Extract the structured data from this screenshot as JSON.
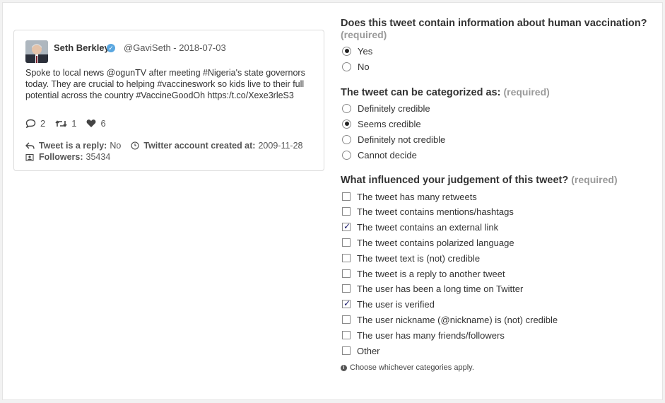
{
  "tweet": {
    "author_name": "Seth Berkley",
    "handle_and_date": "@GaviSeth - 2018-07-03",
    "text": "Spoke to local news @ogunTV after meeting #Nigeria's state governors today. They are crucial to helping #vaccineswork so kids live to their full potential across the country #VaccineGoodOh https:/t.co/Xexe3rleS3",
    "replies": "2",
    "retweets": "1",
    "likes": "6",
    "is_reply_label": "Tweet is a reply:",
    "is_reply_value": "No",
    "account_created_label": "Twitter account created at:",
    "account_created_value": "2009-11-28",
    "followers_label": "Followers:",
    "followers_value": "35434"
  },
  "q1": {
    "title": "Does this tweet contain information about human vaccination?",
    "required": "(required)",
    "options": [
      {
        "label": "Yes",
        "selected": true
      },
      {
        "label": "No",
        "selected": false
      }
    ]
  },
  "q2": {
    "title": "The tweet can be categorized as:",
    "required": "(required)",
    "options": [
      {
        "label": "Definitely credible",
        "selected": false
      },
      {
        "label": "Seems credible",
        "selected": true
      },
      {
        "label": "Definitely not credible",
        "selected": false
      },
      {
        "label": "Cannot decide",
        "selected": false
      }
    ]
  },
  "q3": {
    "title": "What influenced your judgement of this tweet?",
    "required": "(required)",
    "options": [
      {
        "label": "The tweet has many retweets",
        "checked": false
      },
      {
        "label": "The tweet contains mentions/hashtags",
        "checked": false
      },
      {
        "label": "The tweet contains an external link",
        "checked": true
      },
      {
        "label": "The tweet contains polarized language",
        "checked": false
      },
      {
        "label": "The tweet text is (not) credible",
        "checked": false
      },
      {
        "label": "The tweet is a reply to another tweet",
        "checked": false
      },
      {
        "label": "The user has been a long time on Twitter",
        "checked": false
      },
      {
        "label": "The user is verified",
        "checked": true
      },
      {
        "label": "The user nickname (@nickname) is (not) credible",
        "checked": false
      },
      {
        "label": "The user has many friends/followers",
        "checked": false
      },
      {
        "label": "Other",
        "checked": false
      }
    ],
    "hint": "Choose whichever categories apply."
  }
}
